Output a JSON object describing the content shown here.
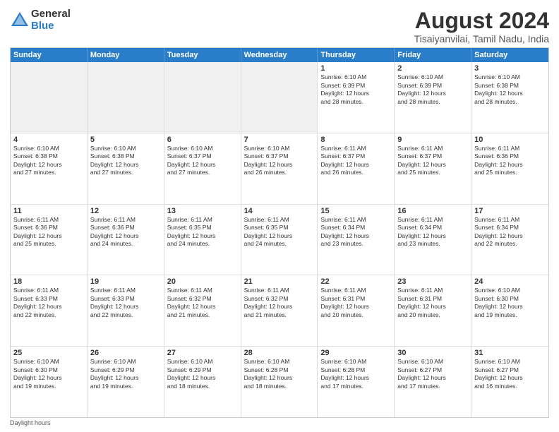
{
  "logo": {
    "general": "General",
    "blue": "Blue"
  },
  "title": "August 2024",
  "subtitle": "Tisaiyanvilai, Tamil Nadu, India",
  "weekdays": [
    "Sunday",
    "Monday",
    "Tuesday",
    "Wednesday",
    "Thursday",
    "Friday",
    "Saturday"
  ],
  "footnote": "Daylight hours",
  "weeks": [
    [
      {
        "day": "",
        "info": ""
      },
      {
        "day": "",
        "info": ""
      },
      {
        "day": "",
        "info": ""
      },
      {
        "day": "",
        "info": ""
      },
      {
        "day": "1",
        "info": "Sunrise: 6:10 AM\nSunset: 6:39 PM\nDaylight: 12 hours\nand 28 minutes."
      },
      {
        "day": "2",
        "info": "Sunrise: 6:10 AM\nSunset: 6:39 PM\nDaylight: 12 hours\nand 28 minutes."
      },
      {
        "day": "3",
        "info": "Sunrise: 6:10 AM\nSunset: 6:38 PM\nDaylight: 12 hours\nand 28 minutes."
      }
    ],
    [
      {
        "day": "4",
        "info": "Sunrise: 6:10 AM\nSunset: 6:38 PM\nDaylight: 12 hours\nand 27 minutes."
      },
      {
        "day": "5",
        "info": "Sunrise: 6:10 AM\nSunset: 6:38 PM\nDaylight: 12 hours\nand 27 minutes."
      },
      {
        "day": "6",
        "info": "Sunrise: 6:10 AM\nSunset: 6:37 PM\nDaylight: 12 hours\nand 27 minutes."
      },
      {
        "day": "7",
        "info": "Sunrise: 6:10 AM\nSunset: 6:37 PM\nDaylight: 12 hours\nand 26 minutes."
      },
      {
        "day": "8",
        "info": "Sunrise: 6:11 AM\nSunset: 6:37 PM\nDaylight: 12 hours\nand 26 minutes."
      },
      {
        "day": "9",
        "info": "Sunrise: 6:11 AM\nSunset: 6:37 PM\nDaylight: 12 hours\nand 25 minutes."
      },
      {
        "day": "10",
        "info": "Sunrise: 6:11 AM\nSunset: 6:36 PM\nDaylight: 12 hours\nand 25 minutes."
      }
    ],
    [
      {
        "day": "11",
        "info": "Sunrise: 6:11 AM\nSunset: 6:36 PM\nDaylight: 12 hours\nand 25 minutes."
      },
      {
        "day": "12",
        "info": "Sunrise: 6:11 AM\nSunset: 6:36 PM\nDaylight: 12 hours\nand 24 minutes."
      },
      {
        "day": "13",
        "info": "Sunrise: 6:11 AM\nSunset: 6:35 PM\nDaylight: 12 hours\nand 24 minutes."
      },
      {
        "day": "14",
        "info": "Sunrise: 6:11 AM\nSunset: 6:35 PM\nDaylight: 12 hours\nand 24 minutes."
      },
      {
        "day": "15",
        "info": "Sunrise: 6:11 AM\nSunset: 6:34 PM\nDaylight: 12 hours\nand 23 minutes."
      },
      {
        "day": "16",
        "info": "Sunrise: 6:11 AM\nSunset: 6:34 PM\nDaylight: 12 hours\nand 23 minutes."
      },
      {
        "day": "17",
        "info": "Sunrise: 6:11 AM\nSunset: 6:34 PM\nDaylight: 12 hours\nand 22 minutes."
      }
    ],
    [
      {
        "day": "18",
        "info": "Sunrise: 6:11 AM\nSunset: 6:33 PM\nDaylight: 12 hours\nand 22 minutes."
      },
      {
        "day": "19",
        "info": "Sunrise: 6:11 AM\nSunset: 6:33 PM\nDaylight: 12 hours\nand 22 minutes."
      },
      {
        "day": "20",
        "info": "Sunrise: 6:11 AM\nSunset: 6:32 PM\nDaylight: 12 hours\nand 21 minutes."
      },
      {
        "day": "21",
        "info": "Sunrise: 6:11 AM\nSunset: 6:32 PM\nDaylight: 12 hours\nand 21 minutes."
      },
      {
        "day": "22",
        "info": "Sunrise: 6:11 AM\nSunset: 6:31 PM\nDaylight: 12 hours\nand 20 minutes."
      },
      {
        "day": "23",
        "info": "Sunrise: 6:11 AM\nSunset: 6:31 PM\nDaylight: 12 hours\nand 20 minutes."
      },
      {
        "day": "24",
        "info": "Sunrise: 6:10 AM\nSunset: 6:30 PM\nDaylight: 12 hours\nand 19 minutes."
      }
    ],
    [
      {
        "day": "25",
        "info": "Sunrise: 6:10 AM\nSunset: 6:30 PM\nDaylight: 12 hours\nand 19 minutes."
      },
      {
        "day": "26",
        "info": "Sunrise: 6:10 AM\nSunset: 6:29 PM\nDaylight: 12 hours\nand 19 minutes."
      },
      {
        "day": "27",
        "info": "Sunrise: 6:10 AM\nSunset: 6:29 PM\nDaylight: 12 hours\nand 18 minutes."
      },
      {
        "day": "28",
        "info": "Sunrise: 6:10 AM\nSunset: 6:28 PM\nDaylight: 12 hours\nand 18 minutes."
      },
      {
        "day": "29",
        "info": "Sunrise: 6:10 AM\nSunset: 6:28 PM\nDaylight: 12 hours\nand 17 minutes."
      },
      {
        "day": "30",
        "info": "Sunrise: 6:10 AM\nSunset: 6:27 PM\nDaylight: 12 hours\nand 17 minutes."
      },
      {
        "day": "31",
        "info": "Sunrise: 6:10 AM\nSunset: 6:27 PM\nDaylight: 12 hours\nand 16 minutes."
      }
    ]
  ]
}
